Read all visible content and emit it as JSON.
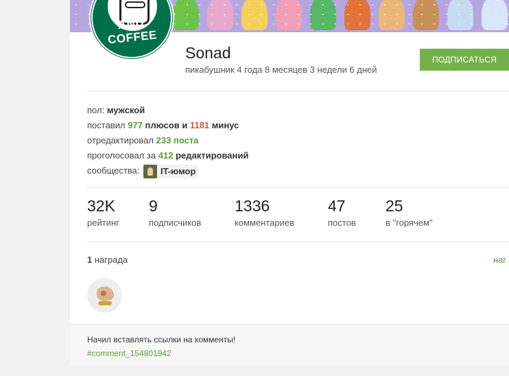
{
  "profile": {
    "username": "Sonad",
    "tenure": "пикабушник 4 года 8 месяцев 3 недели 6 дней",
    "subscribe_label": "ПОДПИСАТЬСЯ",
    "avatar_text": "AND COFFEE"
  },
  "info": {
    "gender_label": "пол:",
    "gender_value": "мужской",
    "voted_prefix": "поставил",
    "pluses": "977",
    "pluses_label": "плюсов и",
    "minuses": "1181",
    "minuses_label": "минус",
    "edited_prefix": "отредактировал",
    "edited_value": "233 поста",
    "voted_edits_prefix": "проголосовал за",
    "voted_edits_count": "412",
    "voted_edits_label": "редактирований",
    "communities_label": "сообщества:",
    "community_name": "IT-юмор"
  },
  "stats": [
    {
      "value": "32K",
      "label": "рейтинг"
    },
    {
      "value": "9",
      "label": "подписчиков"
    },
    {
      "value": "1336",
      "label": "комментариев"
    },
    {
      "value": "47",
      "label": "постов"
    },
    {
      "value": "25",
      "label": "в \"горячем\""
    }
  ],
  "awards": {
    "count": "1",
    "label": "награда",
    "link_text": "наг"
  },
  "footer": {
    "note": "Начил вставлять ссылки на комменты!",
    "link": "#comment_154801942"
  },
  "colors": {
    "accent_green": "#75b14a",
    "link_green": "#5b9e36",
    "minus_red": "#e04e3c",
    "banner": "#b6a6e0"
  }
}
